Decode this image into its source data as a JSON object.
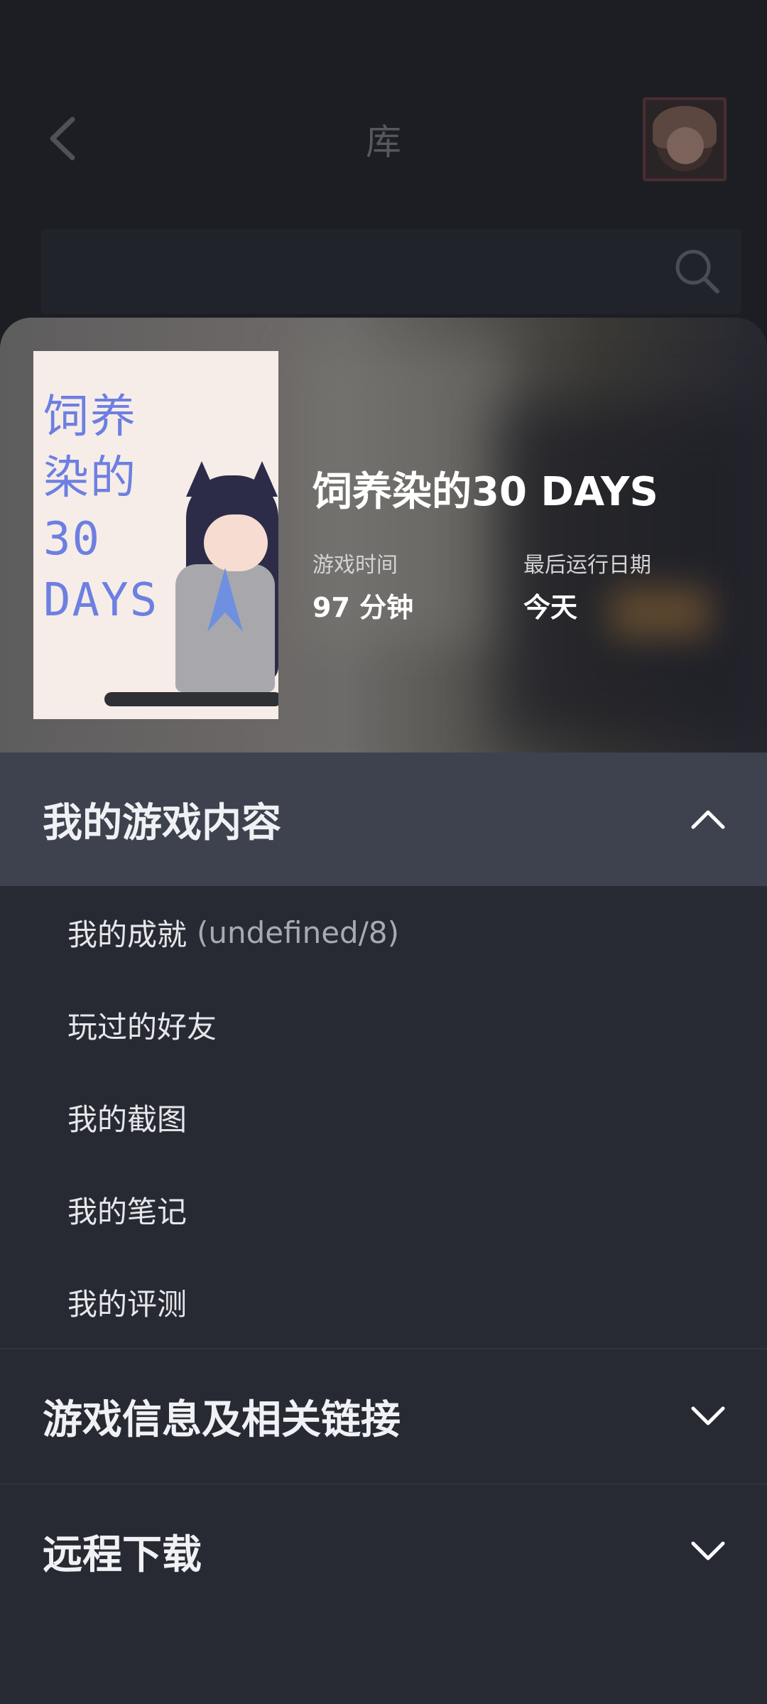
{
  "header": {
    "title": "库",
    "back_icon": "chevron-left-icon",
    "search_icon": "search-icon"
  },
  "game": {
    "title": "饲养染的30 DAYS",
    "cover_title": "饲养\n染的\n30\nDAYS",
    "playtime_label": "游戏时间",
    "playtime_value": "97 分钟",
    "last_run_label": "最后运行日期",
    "last_run_value": "今天"
  },
  "sections": [
    {
      "title": "我的游戏内容",
      "expanded": true,
      "items": [
        {
          "label": "我的成就",
          "count": "(undefined/8)"
        },
        {
          "label": "玩过的好友"
        },
        {
          "label": "我的截图"
        },
        {
          "label": "我的笔记"
        },
        {
          "label": "我的评测"
        }
      ]
    },
    {
      "title": "游戏信息及相关链接",
      "expanded": false
    },
    {
      "title": "远程下载",
      "expanded": false
    }
  ],
  "colors": {
    "sheet_bg": "#272a33",
    "expanded_header_bg": "#3d424e",
    "cover_title": "#6d7fe0"
  }
}
